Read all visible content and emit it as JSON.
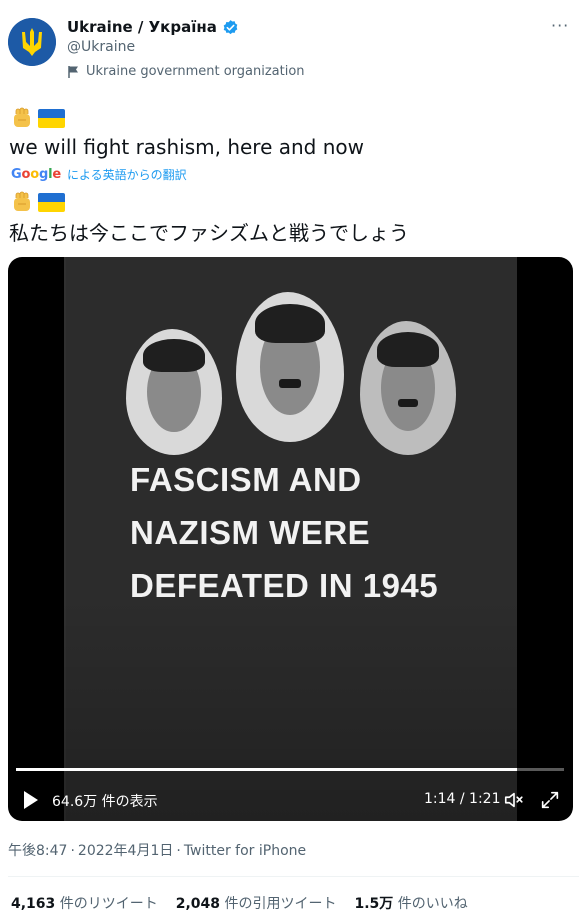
{
  "account": {
    "display_name": "Ukraine / Україна",
    "handle": "@Ukraine",
    "label": "Ukraine government organization"
  },
  "tweet": {
    "original_text": "we will fight rashism, here and now",
    "translate_label": "による英語からの翻訳",
    "translate_source": "Google",
    "translated_text": "私たちは今ここでファシズムと戦うでしょう"
  },
  "video": {
    "caption_lines": [
      "FASCISM AND",
      "NAZISM WERE",
      "DEFEATED IN 1945"
    ],
    "views": "64.6万 件の表示",
    "time": "1:14 / 1:21",
    "progress": 0.914
  },
  "meta": {
    "time": "午後8:47",
    "date": "2022年4月1日",
    "client": "Twitter for iPhone"
  },
  "stats": {
    "retweets_count": "4,163",
    "retweets_label": "件のリツイート",
    "quotes_count": "2,048",
    "quotes_label": "件の引用ツイート",
    "likes_count": "1.5万",
    "likes_label": "件のいいね"
  },
  "colors": {
    "flag_blue": "#1f6fd1",
    "flag_yellow": "#ffd500",
    "verified": "#1d9bf0",
    "link": "#1d9bf0"
  },
  "icons": [
    "trident-avatar-icon",
    "verified-badge-icon",
    "flag-icon",
    "more-icon",
    "raised-fist-icon",
    "ukraine-flag-icon",
    "play-icon",
    "volume-icon",
    "fullscreen-icon"
  ]
}
